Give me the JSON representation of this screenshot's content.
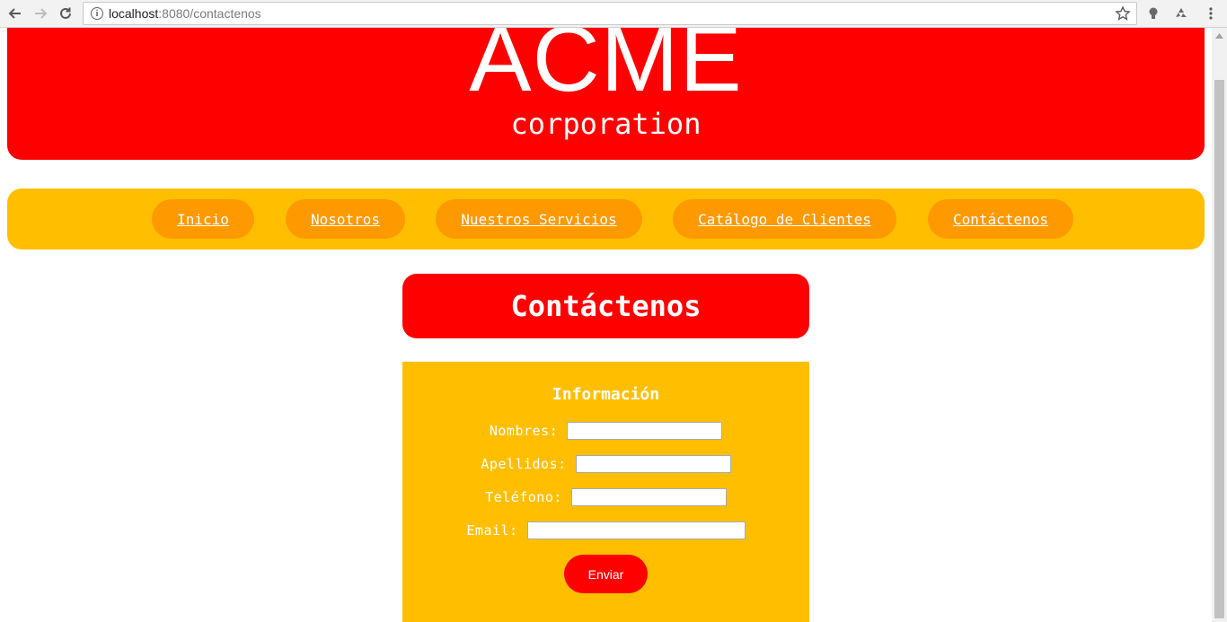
{
  "browser": {
    "url_host": "localhost",
    "url_rest": ":8080/contactenos",
    "icons": [
      "back-arrow-icon",
      "forward-arrow-icon",
      "reload-icon",
      "info-icon",
      "star-icon",
      "bulb-icon",
      "recycle-icon",
      "kebab-menu-icon"
    ]
  },
  "header": {
    "logo": "ACME",
    "tagline": "corporation"
  },
  "nav": {
    "items": [
      {
        "label": "Inicio"
      },
      {
        "label": "Nosotros"
      },
      {
        "label": "Nuestros Servicios"
      },
      {
        "label": "Catálogo de Clientes"
      },
      {
        "label": "Contáctenos"
      }
    ]
  },
  "page": {
    "title": "Contáctenos"
  },
  "form": {
    "heading": "Información",
    "fields": [
      {
        "label": "Nombres:",
        "value": ""
      },
      {
        "label": "Apellidos:",
        "value": ""
      },
      {
        "label": "Teléfono:",
        "value": ""
      },
      {
        "label": "Email:",
        "value": ""
      }
    ],
    "submit_label": "Enviar"
  },
  "colors": {
    "red": "#ff0000",
    "yellow": "#ffbf00",
    "orange": "#ff9900",
    "white": "#ffffff"
  }
}
